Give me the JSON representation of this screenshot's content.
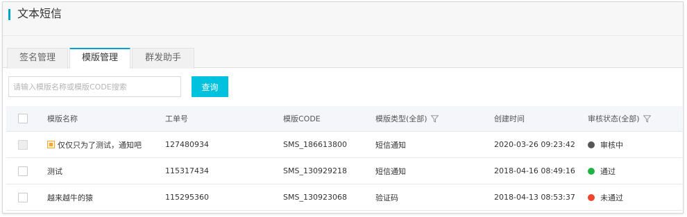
{
  "header": {
    "title": "文本短信"
  },
  "tabs": [
    {
      "label": "签名管理",
      "active": false
    },
    {
      "label": "模版管理",
      "active": true
    },
    {
      "label": "群发助手",
      "active": false
    }
  ],
  "search": {
    "placeholder": "请输入模版名称或模版CODE搜索",
    "button_label": "查询"
  },
  "table": {
    "columns": {
      "name": "模版名称",
      "order": "工单号",
      "code": "模版CODE",
      "type": "模版类型(全部)",
      "time": "创建时间",
      "status": "审核状态(全部)"
    },
    "rows": [
      {
        "name": "仅仅只为了测试，通知吧",
        "order": "127480934",
        "code": "SMS_186613800",
        "type": "短信通知",
        "time": "2020-03-26 09:23:42",
        "status": "审核中",
        "status_color": "#555555",
        "checkbox_disabled": true,
        "has_tag_icon": true
      },
      {
        "name": "测试",
        "order": "115317434",
        "code": "SMS_130929218",
        "type": "短信通知",
        "time": "2018-04-16 08:49:16",
        "status": "通过",
        "status_color": "#1fb343",
        "checkbox_disabled": false,
        "has_tag_icon": false
      },
      {
        "name": "越来越牛的猿",
        "order": "115295360",
        "code": "SMS_130923068",
        "type": "验证码",
        "time": "2018-04-13 08:53:37",
        "status": "未通过",
        "status_color": "#f0442f",
        "checkbox_disabled": false,
        "has_tag_icon": false
      }
    ]
  },
  "colors": {
    "accent": "#00a2ca",
    "button": "#00c1de"
  }
}
